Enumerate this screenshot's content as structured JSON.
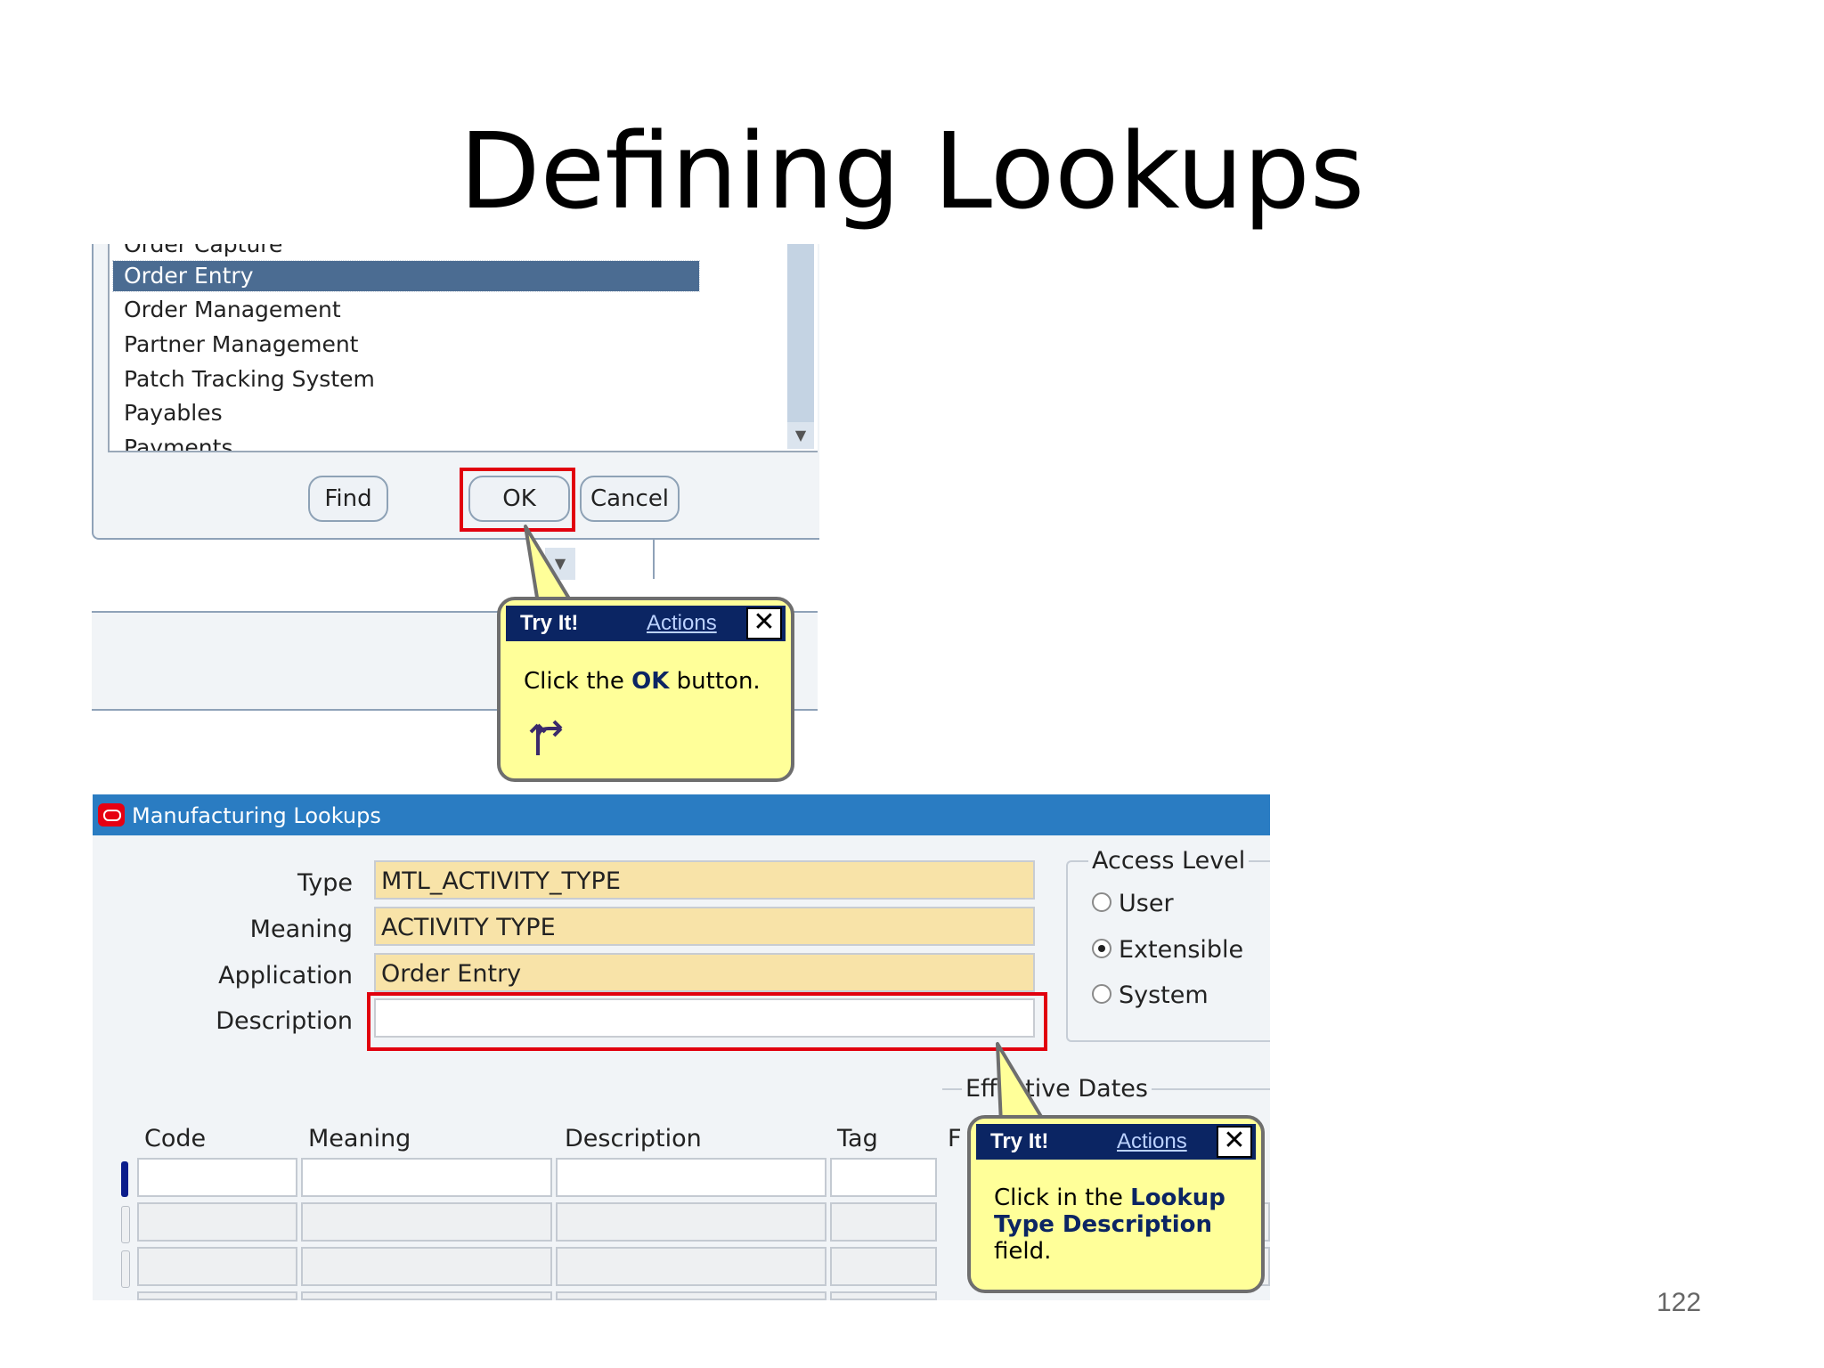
{
  "slide": {
    "title": "Defining Lookups",
    "page_number": "122"
  },
  "list_dialog": {
    "items": [
      {
        "label": "Order Capture",
        "selected": false
      },
      {
        "label": "Order Entry",
        "selected": true
      },
      {
        "label": "Order Management",
        "selected": false
      },
      {
        "label": "Partner Management",
        "selected": false
      },
      {
        "label": "Patch Tracking System",
        "selected": false
      },
      {
        "label": "Payables",
        "selected": false
      },
      {
        "label": "Payments",
        "selected": false
      }
    ],
    "buttons": {
      "find": "Find",
      "ok": "OK",
      "cancel": "Cancel"
    }
  },
  "callout_ok": {
    "header": "Try It!",
    "actions": "Actions",
    "close": "✕",
    "text_before": "Click the ",
    "text_bold": "OK",
    "text_after": " button."
  },
  "window": {
    "title": "Manufacturing Lookups",
    "fields": {
      "type_label": "Type",
      "type_value": "MTL_ACTIVITY_TYPE",
      "meaning_label": "Meaning",
      "meaning_value": "ACTIVITY TYPE",
      "application_label": "Application",
      "application_value": "Order Entry",
      "description_label": "Description",
      "description_value": ""
    },
    "access_level": {
      "legend": "Access Level",
      "options": [
        {
          "label": "User",
          "checked": false
        },
        {
          "label": "Extensible",
          "checked": true
        },
        {
          "label": "System",
          "checked": false
        }
      ]
    },
    "effective_dates_legend": "Effective Dates",
    "columns": [
      "Code",
      "Meaning",
      "Description",
      "Tag",
      "F"
    ]
  },
  "callout_description": {
    "header": "Try It!",
    "actions": "Actions",
    "close": "✕",
    "line1_before": "Click in the ",
    "line1_bold": "Lookup",
    "line2_bold": "Type Description",
    "line3": "field."
  },
  "colors": {
    "title_bar": "#2a7cc2",
    "selection": "#4b6c92",
    "callout_fill": "#ffff99",
    "callout_header": "#0b2563",
    "highlight": "#e1000e",
    "required_field": "#f8e3a8"
  },
  "icons": [
    "oracle-window-icon",
    "close-icon",
    "scroll-down-icon",
    "branch-arrow-icon"
  ]
}
